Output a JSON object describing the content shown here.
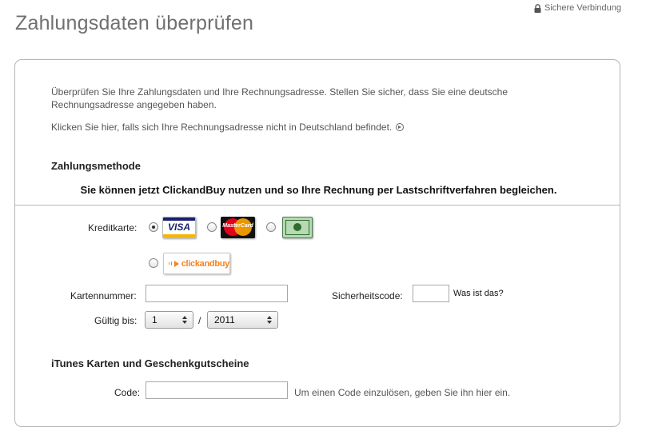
{
  "header": {
    "title": "Zahlungsdaten überprüfen",
    "secure_label": "Sichere Verbindung"
  },
  "intro": {
    "text": "Überprüfen Sie Ihre Zahlungsdaten und Ihre Rechnungsadresse. Stellen Sie sicher, dass Sie eine deutsche Rechnungsadresse angegeben haben.",
    "foreign_link": "Klicken Sie hier, falls sich Ihre Rechnungsadresse nicht in Deutschland befindet."
  },
  "payment": {
    "section_title": "Zahlungsmethode",
    "notice": "Sie können jetzt ClickandBuy nutzen und so Ihre Rechnung per Lastschriftverfahren begleichen.",
    "card_label": "Kreditkarte:",
    "card_options": [
      "VISA",
      "MasterCard",
      "American Express",
      "clickandbuy"
    ],
    "selected_option": "VISA",
    "visa_text": "VISA",
    "mastercard_text": "MasterCard",
    "clickandbuy_text": "clickandbuy",
    "card_number_label": "Kartennummer:",
    "card_number_value": "",
    "security_code_label": "Sicherheitscode:",
    "security_code_value": "",
    "what_is_this": "Was ist das?",
    "valid_until_label": "Gültig bis:",
    "month_value": "1",
    "separator": "/",
    "year_value": "2011"
  },
  "gift": {
    "section_title": "iTunes Karten und Geschenkgutscheine",
    "code_label": "Code:",
    "code_value": "",
    "code_hint": "Um einen Code einzulösen, geben Sie ihn hier ein."
  },
  "colors": {
    "visa_blue": "#1a1f71",
    "visa_gold": "#f7b600",
    "mc_red": "#e3001b",
    "mc_orange": "#f59e00",
    "clickandbuy_orange": "#f5821f",
    "amex_green": "#b7d9b4"
  }
}
